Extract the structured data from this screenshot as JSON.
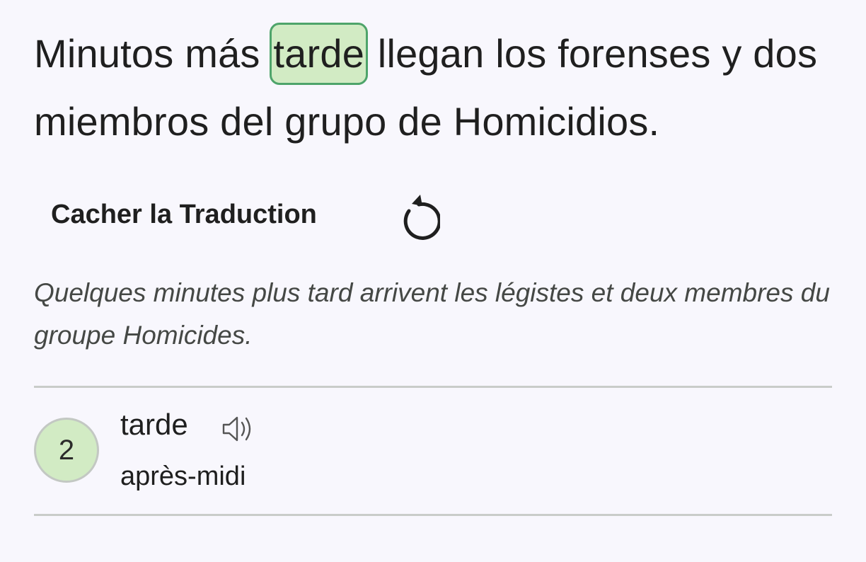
{
  "sentence": {
    "before": "Minutos más ",
    "highlighted_word": "tarde",
    "after": " llegan los forenses y dos miembros del grupo de Homicidios."
  },
  "translation_toggle": {
    "label": "Cacher la Traduction",
    "icon": "replay-icon"
  },
  "translation": {
    "text": "Quelques minutes plus tard arrivent les légistes et deux membres du groupe Homicides."
  },
  "vocabulary": [
    {
      "count": "2",
      "word": "tarde",
      "meaning": "après-midi",
      "icon": "speaker-icon"
    }
  ],
  "colors": {
    "background": "#f8f7fd",
    "highlight_fill": "#d2ebc4",
    "highlight_border": "#4ea46a",
    "translation_text": "#454845",
    "divider": "#c9ccc9"
  }
}
